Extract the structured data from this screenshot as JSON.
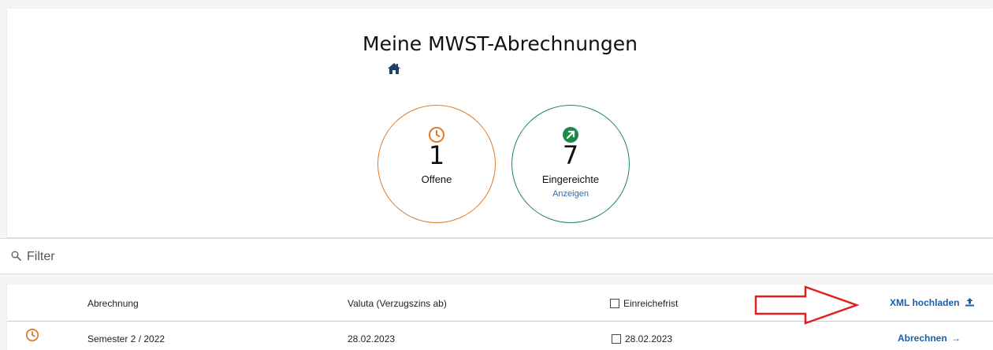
{
  "header": {
    "title": "Meine MWST-Abrechnungen"
  },
  "summary": {
    "open": {
      "count": "1",
      "label": "Offene",
      "color": "#e07b2a",
      "icon": "clock-icon"
    },
    "submitted": {
      "count": "7",
      "label": "Eingereichte",
      "link": "Anzeigen",
      "color": "#1b8a4a",
      "icon": "arrow-up-right-icon"
    }
  },
  "filter": {
    "placeholder": "Filter"
  },
  "table": {
    "columns": {
      "abrechnung": "Abrechnung",
      "valuta": "Valuta (Verzugszins ab)",
      "einreichefrist": "Einreichefrist",
      "xml_upload": "XML hochladen"
    },
    "rows": [
      {
        "status_icon": "clock-icon",
        "abrechnung": "Semester 2 / 2022",
        "valuta": "28.02.2023",
        "einreichefrist": "28.02.2023",
        "action": "Abrechnen"
      }
    ]
  },
  "colors": {
    "link": "#1a5fa8",
    "annotation_arrow": "#e02020"
  }
}
